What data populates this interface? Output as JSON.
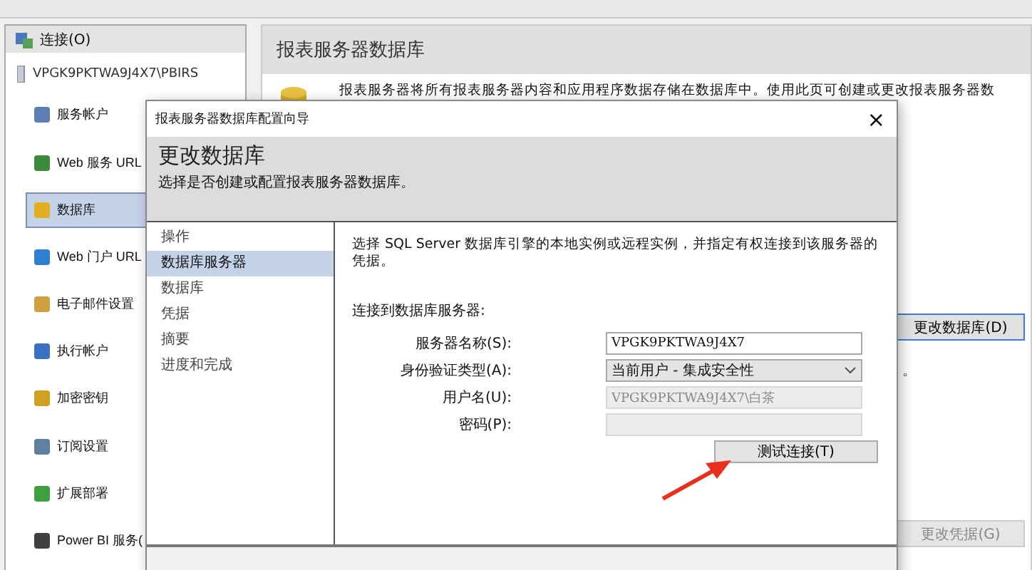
{
  "sidebar": {
    "header": "连接(O)",
    "server": "VPGK9PKTWA9J4X7\\PBIRS",
    "items": [
      {
        "label": "服务帐户",
        "selected": false
      },
      {
        "label": "Web 服务 URL",
        "selected": false
      },
      {
        "label": "数据库",
        "selected": true
      },
      {
        "label": "Web 门户 URL",
        "selected": false
      },
      {
        "label": "电子邮件设置",
        "selected": false
      },
      {
        "label": "执行帐户",
        "selected": false
      },
      {
        "label": "加密密钥",
        "selected": false
      },
      {
        "label": "订阅设置",
        "selected": false
      },
      {
        "label": "扩展部署",
        "selected": false
      },
      {
        "label": "Power BI 服务(",
        "selected": false
      }
    ]
  },
  "page": {
    "title": "报表服务器数据库",
    "description": "报表服务器将所有报表服务器内容和应用程序数据存储在数据库中。使用此页可创建或更改报表服务器数",
    "mark": "。",
    "change_database_button": "更改数据库(D)",
    "change_credentials_button": {
      "label": "更改凭据(G)",
      "disabled": true
    }
  },
  "dialog": {
    "title": "报表服务器数据库配置向导",
    "close": "×",
    "heading": "更改数据库",
    "subheading": "选择是否创建或配置报表服务器数据库。",
    "steps": [
      {
        "label": "操作",
        "selected": false
      },
      {
        "label": "数据库服务器",
        "selected": true
      },
      {
        "label": "数据库",
        "selected": false
      },
      {
        "label": "凭据",
        "selected": false
      },
      {
        "label": "摘要",
        "selected": false
      },
      {
        "label": "进度和完成",
        "selected": false
      }
    ],
    "intro": "选择 SQL Server 数据库引擎的本地实例或远程实例，并指定有权连接到该服务器的凭据。",
    "section": "连接到数据库服务器:",
    "fields": [
      {
        "kind": "input",
        "label": "服务器名称(S):",
        "value": "VPGK9PKTWA9J4X7",
        "disabled": false
      },
      {
        "kind": "select",
        "label": "身份验证类型(A):",
        "value": "当前用户 - 集成安全性"
      },
      {
        "kind": "input",
        "label": "用户名(U):",
        "value": "VPGK9PKTWA9J4X7\\白茶",
        "disabled": true
      },
      {
        "kind": "input",
        "label": "密码(P):",
        "disabled": true
      }
    ],
    "test_button": "测试连接(T)"
  }
}
